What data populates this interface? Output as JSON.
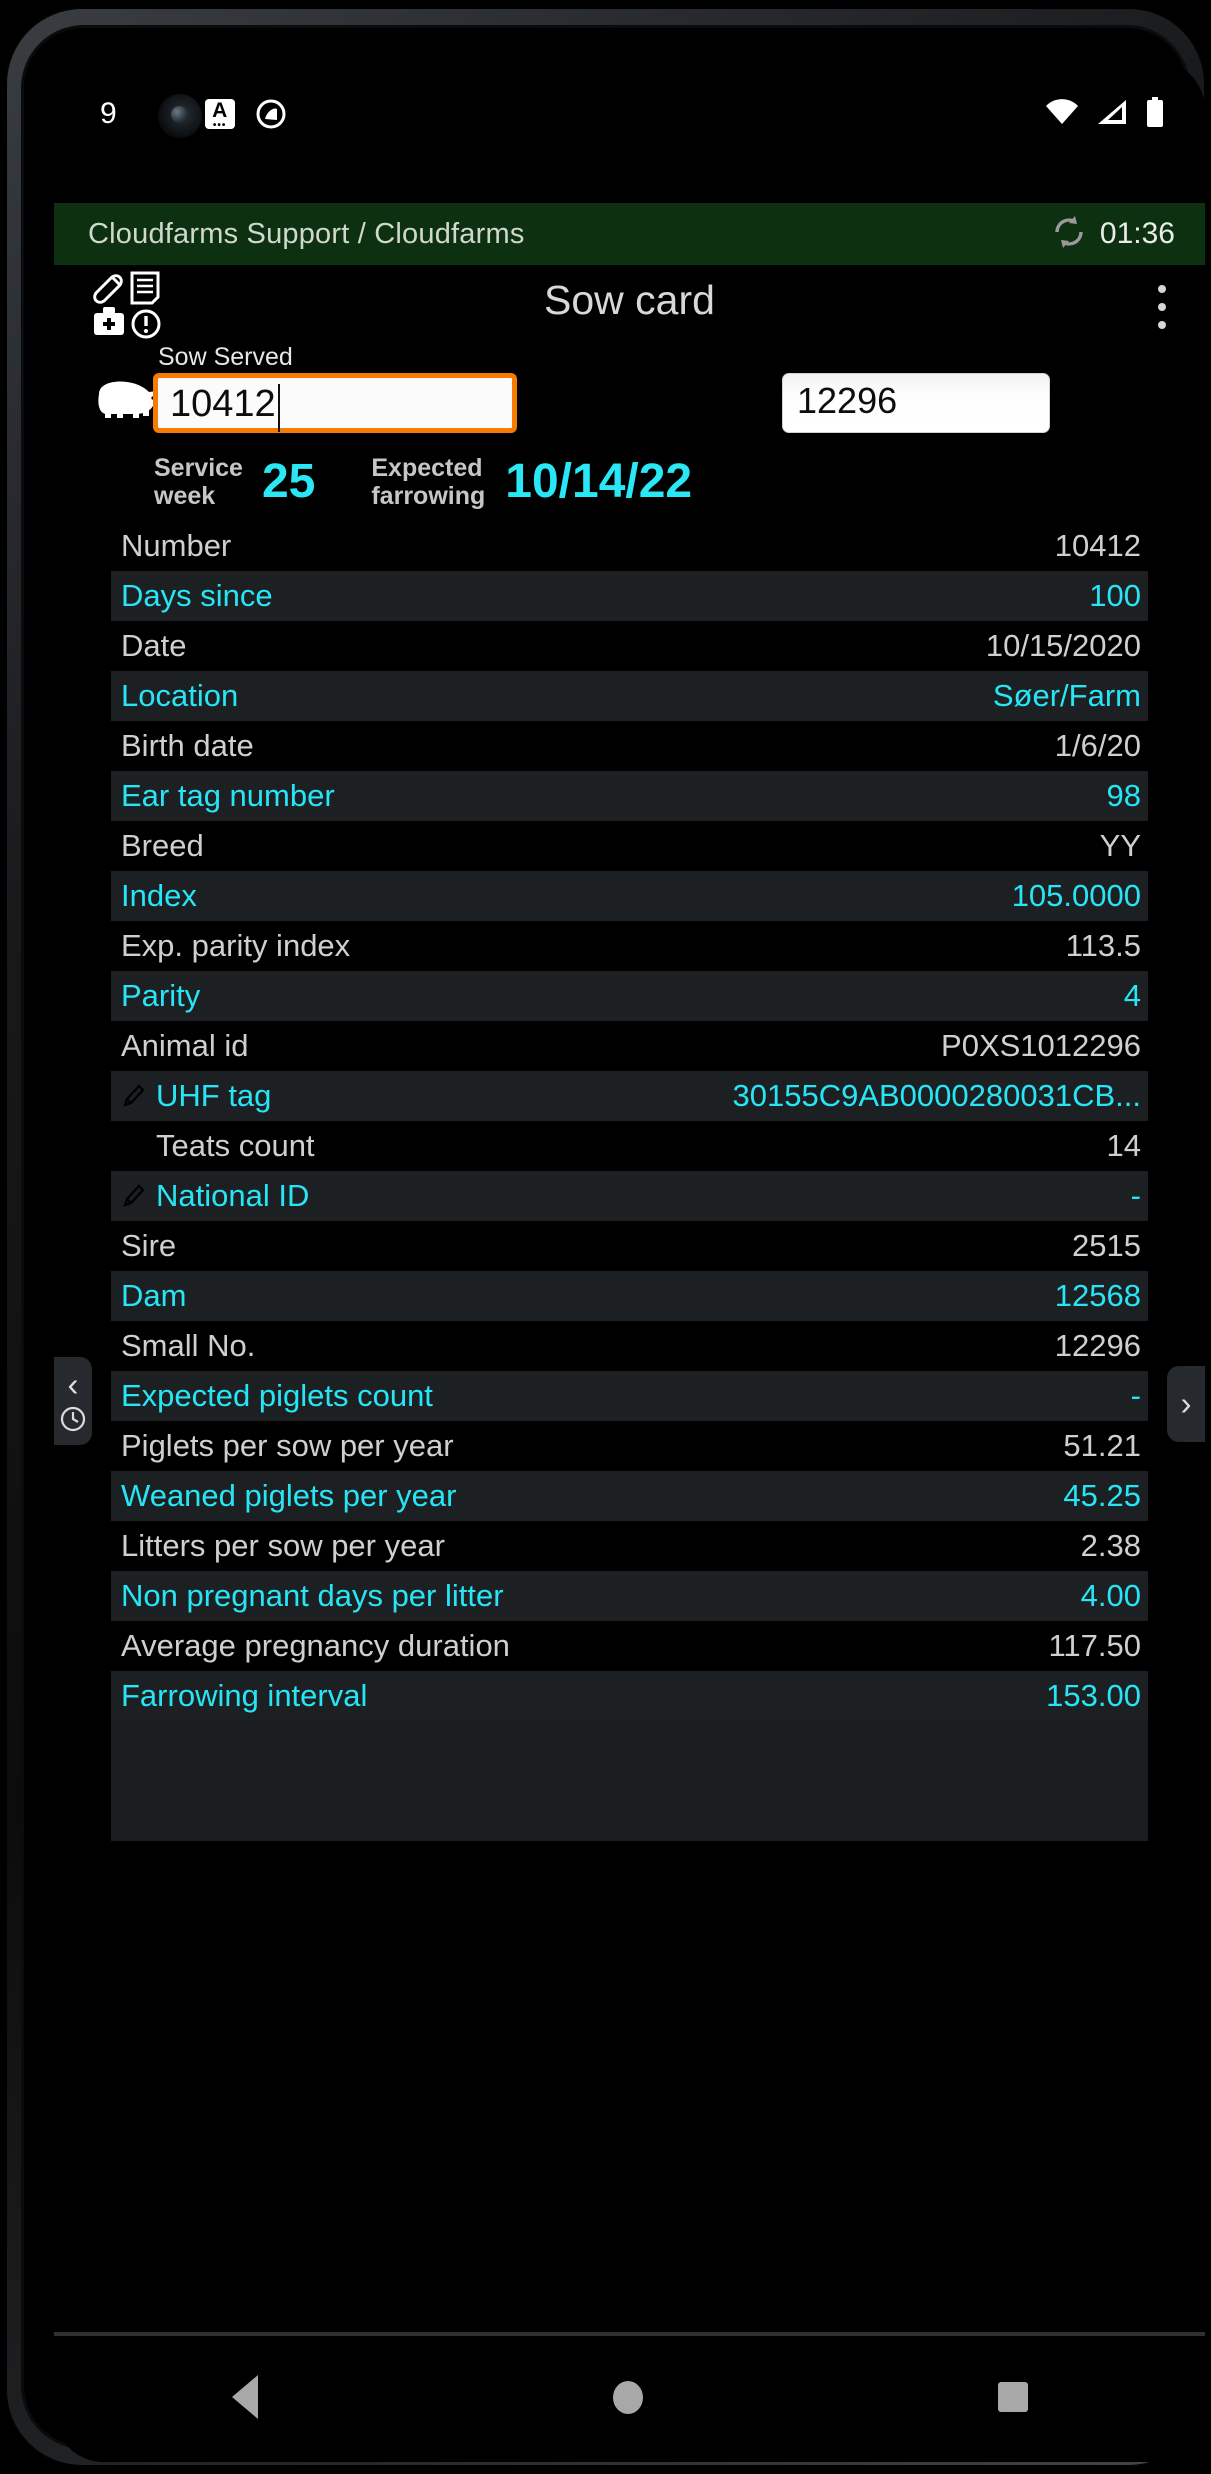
{
  "statusbar": {
    "left_number": "9",
    "keyboard_icon_letter": "A",
    "icons": [
      "keyboard-a-icon",
      "quick-settings-icon",
      "wifi-icon",
      "signal-icon",
      "battery-icon"
    ]
  },
  "farmbar": {
    "title": "Cloudfarms Support / Cloudfarms",
    "sync_icon": "sync-icon",
    "timer": "01:36",
    "background_color": "#0d3010"
  },
  "appbar": {
    "title": "Sow card",
    "left_icons": [
      "ham-icon",
      "document-icon",
      "medical-kit-icon",
      "warning-icon"
    ],
    "menu_icon": "overflow-menu-icon"
  },
  "search": {
    "label": "Sow Served",
    "pig_icon": "pig-icon",
    "primary_value": "10412",
    "secondary_value": "12296"
  },
  "summary": {
    "service_week_label": "Service week",
    "service_week_value": "25",
    "expected_farrowing_label": "Expected farrowing",
    "expected_farrowing_value": "10/14/22",
    "accent_color": "#29e7f4"
  },
  "sidenav": {
    "left_chevron": "chevron-left-icon",
    "history_icon": "clock-icon",
    "right_chevron": "chevron-right-icon"
  },
  "navbar": {
    "back": "back-triangle-icon",
    "home": "home-circle-icon",
    "recents": "recents-square-icon"
  },
  "rows": [
    {
      "label": "Number",
      "value": "10412",
      "style": "gray",
      "editable": false
    },
    {
      "label": "Days since",
      "value": "100",
      "style": "cyan",
      "editable": false
    },
    {
      "label": "Date",
      "value": "10/15/2020",
      "style": "gray",
      "editable": false
    },
    {
      "label": "Location",
      "value": "Søer/Farm",
      "style": "cyan",
      "editable": false
    },
    {
      "label": "Birth date",
      "value": "1/6/20",
      "style": "gray",
      "editable": false
    },
    {
      "label": "Ear tag number",
      "value": "98",
      "style": "cyan",
      "editable": false
    },
    {
      "label": "Breed",
      "value": "YY",
      "style": "gray",
      "editable": false
    },
    {
      "label": "Index",
      "value": "105.0000",
      "style": "cyan",
      "editable": false
    },
    {
      "label": "Exp. parity index",
      "value": "113.5",
      "style": "gray",
      "editable": false
    },
    {
      "label": "Parity",
      "value": "4",
      "style": "cyan",
      "editable": false
    },
    {
      "label": "Animal id",
      "value": "P0XS1012296",
      "style": "gray",
      "editable": false
    },
    {
      "label": "UHF tag",
      "value": "30155C9AB0000280031CB...",
      "style": "cyan",
      "editable": true
    },
    {
      "label": "Teats count",
      "value": "14",
      "style": "gray",
      "editable": true
    },
    {
      "label": "National ID",
      "value": "-",
      "style": "cyan",
      "editable": true
    },
    {
      "label": "Sire",
      "value": "2515",
      "style": "gray",
      "editable": false
    },
    {
      "label": "Dam",
      "value": "12568",
      "style": "cyan",
      "editable": false
    },
    {
      "label": "Small No.",
      "value": "12296",
      "style": "gray",
      "editable": false
    },
    {
      "label": "Expected piglets count",
      "value": "-",
      "style": "cyan",
      "editable": false
    },
    {
      "label": "Piglets per sow per year",
      "value": "51.21",
      "style": "gray",
      "editable": false
    },
    {
      "label": "Weaned piglets per year",
      "value": "45.25",
      "style": "cyan",
      "editable": false
    },
    {
      "label": "Litters per sow per year",
      "value": "2.38",
      "style": "gray",
      "editable": false
    },
    {
      "label": "Non pregnant days per litter",
      "value": "4.00",
      "style": "cyan",
      "editable": false
    },
    {
      "label": "Average pregnancy duration",
      "value": "117.50",
      "style": "gray",
      "editable": false
    },
    {
      "label": "Farrowing interval",
      "value": "153.00",
      "style": "cyan",
      "editable": false
    }
  ]
}
